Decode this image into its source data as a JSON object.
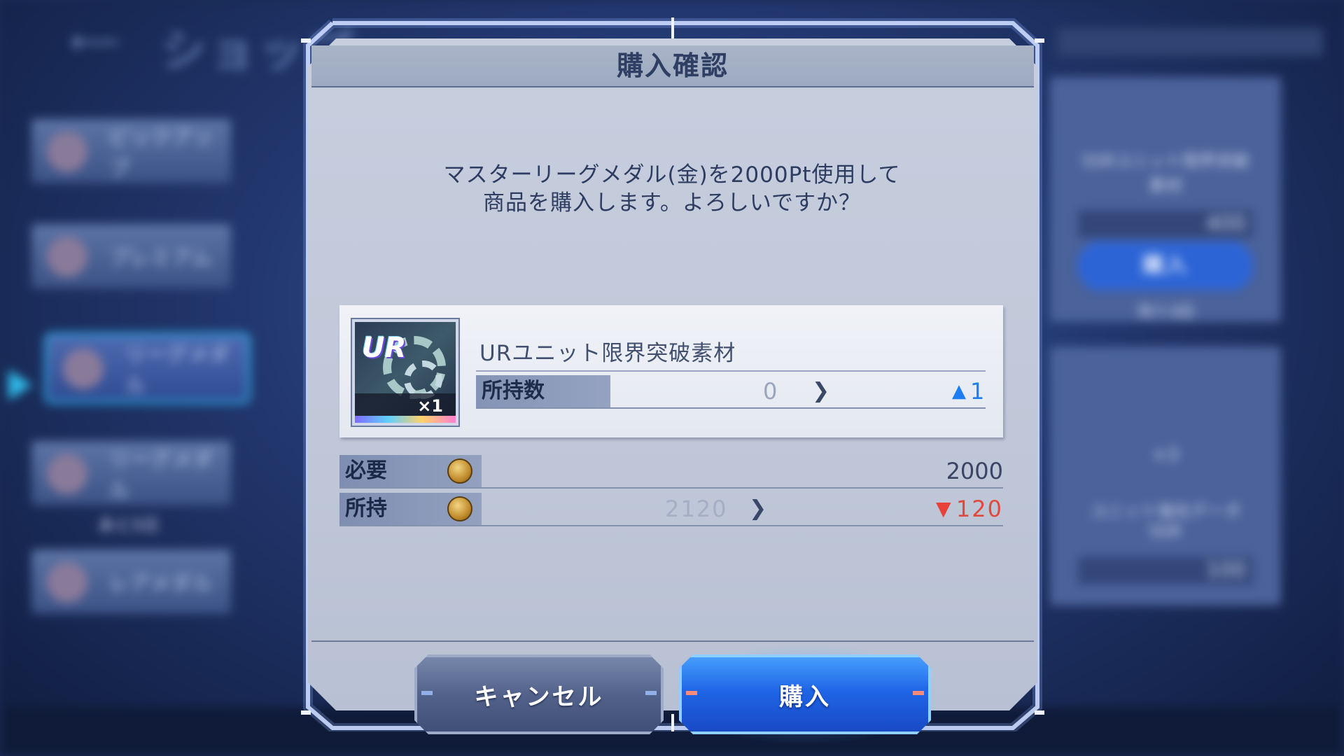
{
  "background": {
    "screen_title": "ショップ",
    "tabs": [
      {
        "label": "ピックアップ",
        "selected": false
      },
      {
        "label": "プレミアム",
        "selected": false
      },
      {
        "label": "リーグメダル",
        "selected": true
      },
      {
        "label": "リーグメダル",
        "selected": false
      },
      {
        "label": "レアメダル",
        "selected": false
      }
    ],
    "tab_sublabel": "あと5日",
    "side_card": {
      "name": "SSRユニット限界突破素材",
      "price": "400",
      "button": "購入",
      "remaining": "残り3回"
    },
    "side_card2": {
      "qty": "×3",
      "name": "ユニット強化データSSR",
      "price": "100"
    }
  },
  "dialog": {
    "title": "購入確認",
    "message_line1": "マスターリーグメダル(金)を2000Pt使用して",
    "message_line2": "商品を購入します。よろしいですか？",
    "item": {
      "badge": "UR",
      "quantity": "×1",
      "name": "URユニット限界突破素材",
      "owned_label": "所持数",
      "owned_before": "0",
      "owned_after": "1",
      "arrow_icon": "chevron-right-icon",
      "increase_icon": "up-arrow-icon"
    },
    "cost": {
      "required_label": "必要",
      "required_value": "2000",
      "have_label": "所持",
      "have_before": "2120",
      "have_after": "120",
      "decrease_icon": "down-arrow-icon",
      "coin_icon": "master-league-medal-icon"
    },
    "buttons": {
      "cancel": "キャンセル",
      "buy": "購入"
    },
    "colors": {
      "increase": "#1e7df0",
      "decrease": "#e04a3c",
      "buy_button": "#1f66e6",
      "cancel_button": "#52628a"
    }
  }
}
